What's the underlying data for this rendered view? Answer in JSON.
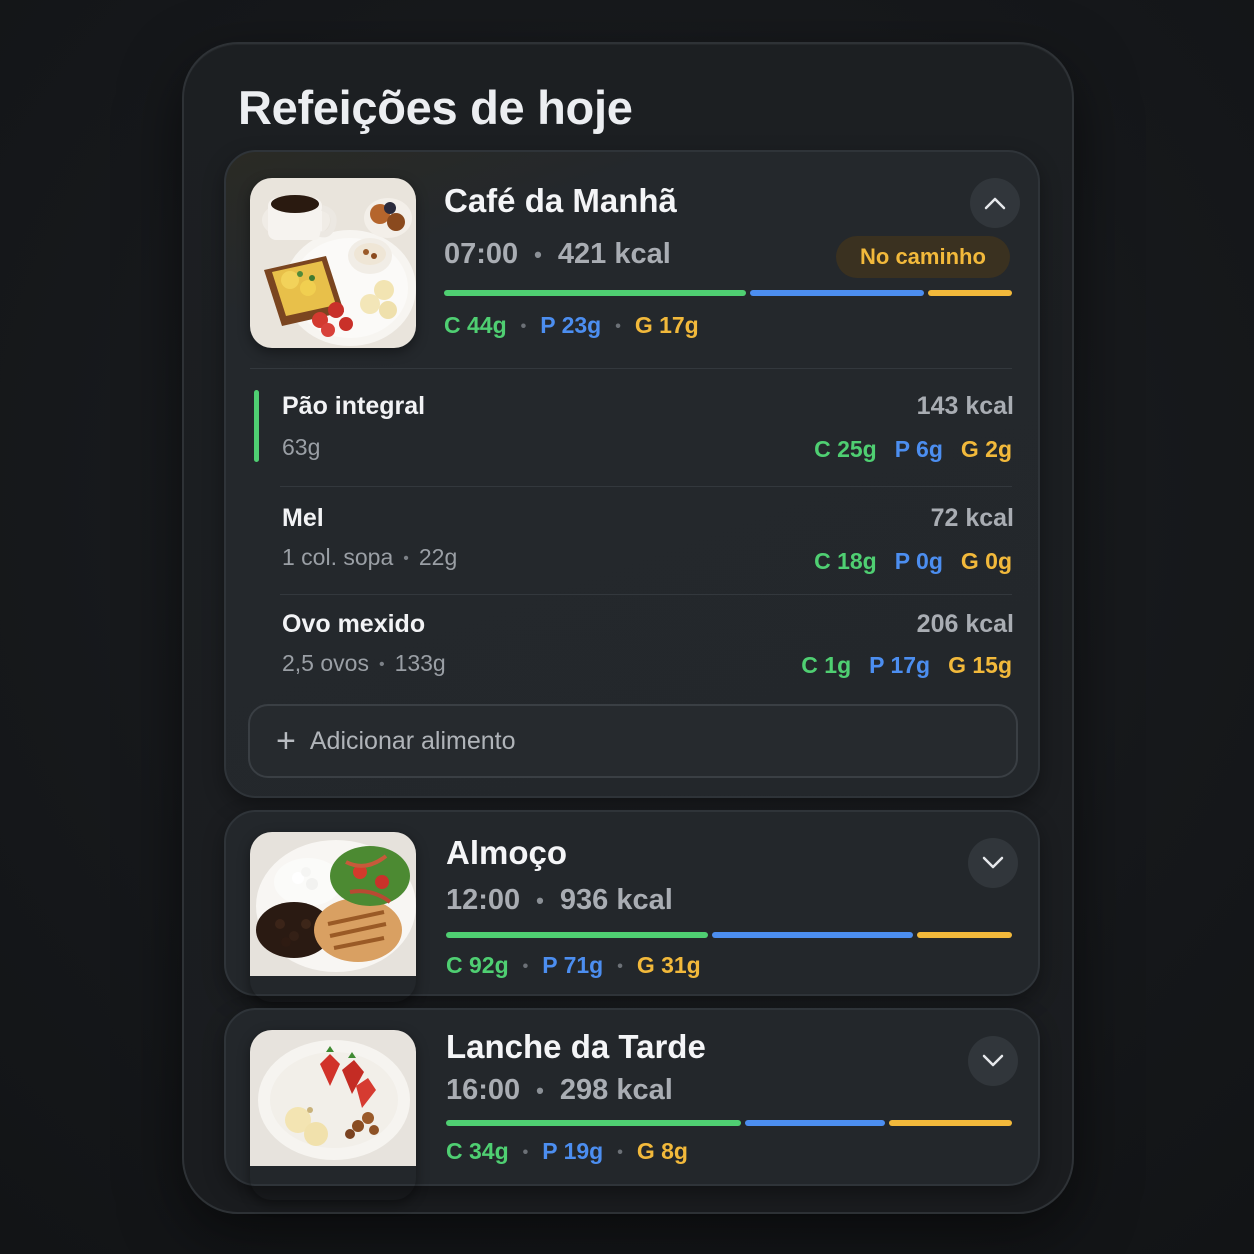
{
  "page": {
    "title": "Refeições de hoje"
  },
  "meals": [
    {
      "name": "Café da Manhã",
      "time": "07:00",
      "kcal": "421 kcal",
      "status": "No caminho",
      "expanded": true,
      "toggle_icon": "chevron-up-icon",
      "macros": {
        "c": "C 44g",
        "p": "P 23g",
        "g": "G 17g"
      },
      "macro_split": [
        0.54,
        0.31,
        0.15
      ],
      "foods": [
        {
          "name": "Pão integral",
          "portion": "63g",
          "portion_extra": "",
          "kcal": "143 kcal",
          "c": "C 25g",
          "p": "P 6g",
          "g": "G 2g"
        },
        {
          "name": "Mel",
          "portion": "1 col. sopa",
          "portion_extra": "22g",
          "kcal": "72 kcal",
          "c": "C 18g",
          "p": "P 0g",
          "g": "G 0g"
        },
        {
          "name": "Ovo mexido",
          "portion": "2,5 ovos",
          "portion_extra": "133g",
          "kcal": "206 kcal",
          "c": "C 1g",
          "p": "P 17g",
          "g": "G 15g"
        }
      ],
      "add_label": "Adicionar alimento"
    },
    {
      "name": "Almoço",
      "time": "12:00",
      "kcal": "936 kcal",
      "expanded": false,
      "toggle_icon": "chevron-down-icon",
      "macros": {
        "c": "C 92g",
        "p": "P 71g",
        "g": "G 31g"
      },
      "macro_split": [
        0.47,
        0.36,
        0.17
      ]
    },
    {
      "name": "Lanche da Tarde",
      "time": "16:00",
      "kcal": "298 kcal",
      "expanded": false,
      "toggle_icon": "chevron-down-icon",
      "macros": {
        "c": "C 34g",
        "p": "P 19g",
        "g": "G 8g"
      },
      "macro_split": [
        0.53,
        0.25,
        0.22
      ]
    }
  ],
  "colors": {
    "carb": "#4fcf72",
    "protein": "#4c8ef0",
    "fat": "#f2b93b",
    "status_text": "#f2b93b"
  }
}
